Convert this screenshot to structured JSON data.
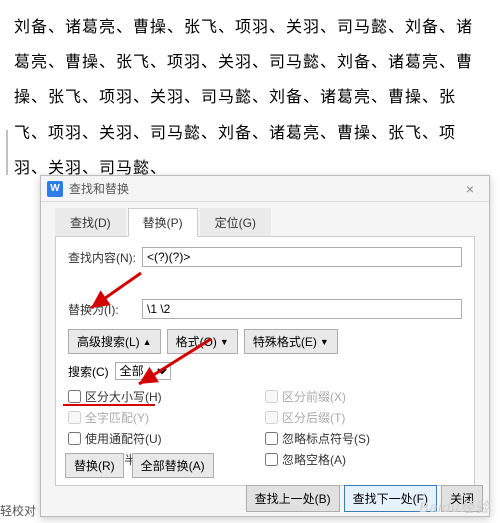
{
  "document_text": "刘备、诸葛亮、曹操、张飞、项羽、关羽、司马懿、刘备、诸葛亮、曹操、张飞、项羽、关羽、司马懿、刘备、诸葛亮、曹操、张飞、项羽、关羽、司马懿、刘备、诸葛亮、曹操、张飞、项羽、关羽、司马懿、刘备、诸葛亮、曹操、张飞、项羽、关羽、司马懿、",
  "dialog": {
    "title": "查找和替换",
    "close": "×"
  },
  "tabs": {
    "find": "查找(D)",
    "replace": "替换(P)",
    "goto": "定位(G)"
  },
  "fields": {
    "find_label": "查找内容(N):",
    "find_value": "<(?)(?)>",
    "replace_label": "替换为(I):",
    "replace_value": "\\1 \\2"
  },
  "buttons": {
    "advanced": "高级搜索(L)",
    "format": "格式(O)",
    "special": "特殊格式(E)"
  },
  "search": {
    "label": "搜索(C)",
    "value": "全部"
  },
  "checks": {
    "match_case": "区分大小写(H)",
    "prefix": "区分前缀(X)",
    "whole_word": "全字匹配(Y)",
    "suffix": "区分后缀(T)",
    "wildcards": "使用通配符(U)",
    "ignore_punct": "忽略标点符号(S)",
    "full_half": "区分全/半角(M)",
    "ignore_space": "忽略空格(A)"
  },
  "bottom": {
    "replace": "替换(R)",
    "replace_all": "全部替换(A)"
  },
  "footer": {
    "prev": "查找上一处(B)",
    "next": "查找下一处(F)",
    "close": "关闭"
  },
  "watermark": "Baidu经验",
  "sidetext": "轻校对"
}
